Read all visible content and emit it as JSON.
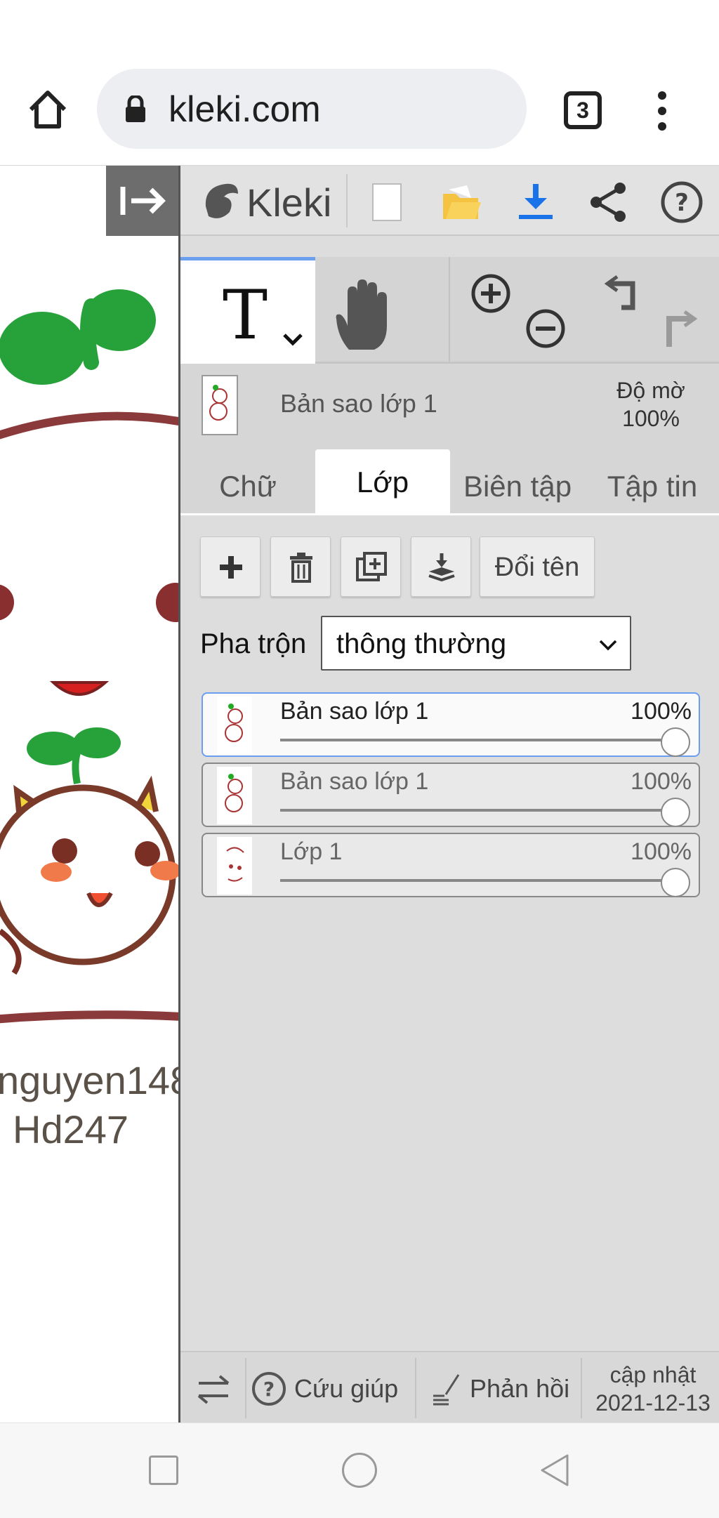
{
  "browser": {
    "url": "kleki.com",
    "tab_count": "3"
  },
  "canvas": {
    "text_line1": "nguyen148",
    "text_line2": "Hd247"
  },
  "panel": {
    "logo": "Kleki",
    "layer_preview_name": "Bản sao lớp 1",
    "opacity_label_line1": "Độ mờ",
    "opacity_label_line2": "100%",
    "tabs": [
      {
        "label": "Chữ",
        "active": false
      },
      {
        "label": "Lớp",
        "active": true
      },
      {
        "label": "Biên tập",
        "active": false
      },
      {
        "label": "Tập tin",
        "active": false
      }
    ],
    "rename_label": "Đổi tên",
    "blend_label": "Pha trộn",
    "blend_value": "thông thường",
    "layers": [
      {
        "name": "Bản sao lớp 1",
        "opacity": "100%",
        "opacity_value": 1.0,
        "selected": true
      },
      {
        "name": "Bản sao lớp 1",
        "opacity": "100%",
        "opacity_value": 1.0,
        "selected": false
      },
      {
        "name": "Lớp 1",
        "opacity": "100%",
        "opacity_value": 1.0,
        "selected": false
      }
    ],
    "footer": {
      "help_label": "Cứu giúp",
      "feedback_label": "Phản hồi",
      "update_line1": "cập nhật",
      "update_line2": "2021-12-13"
    }
  },
  "colors": {
    "accent_blue": "#6ba0f0",
    "download_blue": "#1a73e8",
    "folder_yellow": "#f5c342",
    "panel_bg": "#dddddd"
  }
}
